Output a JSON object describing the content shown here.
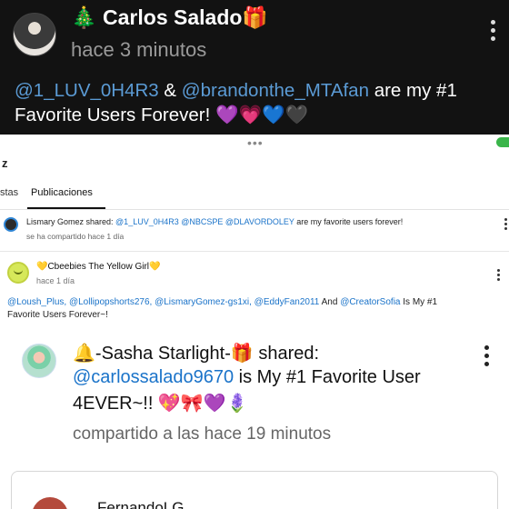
{
  "top_post": {
    "author": "🎄 Carlos Salado🎁",
    "timestamp": "hace 3 minutos",
    "mention_1": "@1_LUV_0H4R3",
    "connector": " & ",
    "mention_2": "@brandonthe_MTAfan",
    "text_rest": " are my #1",
    "text_line2": "Favorite Users Forever! 💜💗💙🖤"
  },
  "sheet": {
    "handle": "•••",
    "partial_title": "z",
    "tabs": [
      {
        "label": "stas"
      },
      {
        "label": "Publicaciones"
      }
    ]
  },
  "share_row": {
    "author": "Lismary Gomez shared: ",
    "mentions": "@1_LUV_0H4R3 @NBCSPE @DLAVORDOLEY",
    "text_rest": " are my favorite users forever!",
    "timestamp": "se ha compartido hace 1 día"
  },
  "post2": {
    "author": "💛Cbeebies The Yellow Girl💛",
    "timestamp": "hace 1 día",
    "mentions": "@Loush_Plus, @Lollipopshorts276, @LismaryGomez-gs1xi, @EddyFan2011",
    "text_and": " And ",
    "mention_last": "@CreatorSofia",
    "text_rest": " Is My #1",
    "text_line2": "Favorite Users Forever~!"
  },
  "shared_post": {
    "author": "🔔-Sasha Starlight-🎁 shared:",
    "mention": "@carlossalado9670",
    "text_rest": " is My #1 Favorite User",
    "text_line2": "4EVER~!! 💖🎀💜🪻",
    "timestamp": "compartido a las hace 19 minutos"
  },
  "bottom_card": {
    "author": "FernandoLG"
  }
}
